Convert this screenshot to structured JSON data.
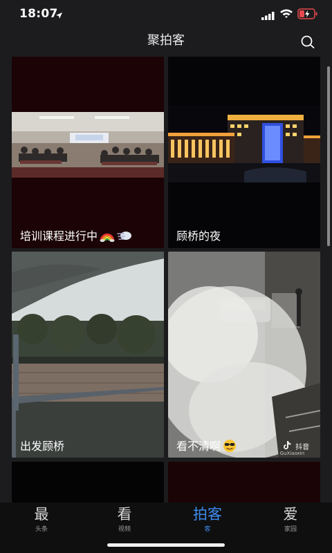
{
  "status_bar": {
    "time": "18:07",
    "icons": [
      "location-arrow-icon",
      "cellular-signal-icon",
      "wifi-icon",
      "battery-charging-icon"
    ]
  },
  "header": {
    "title": "聚拍客",
    "search_icon": "search-icon"
  },
  "grid": [
    {
      "label": "培训课程进行中",
      "emojis": [
        "rainbow-emoji",
        "wind-cloud-emoji"
      ]
    },
    {
      "label": "顾桥的夜",
      "emojis": []
    },
    {
      "label": "出发顾桥",
      "emojis": []
    },
    {
      "label": "看不清啊",
      "emojis": [
        "sunglasses-face-emoji"
      ],
      "watermark_brand": "抖音",
      "watermark_account": "我的抖音号: GuXiaoxin"
    }
  ],
  "tabs": [
    {
      "glyph": "最",
      "sub": "头条",
      "active": false
    },
    {
      "glyph": "看",
      "sub": "视频",
      "active": false
    },
    {
      "glyph": "拍客",
      "sub": "客",
      "active": true
    },
    {
      "glyph": "爱",
      "sub": "家园",
      "active": false
    }
  ],
  "colors": {
    "background": "#1c1c1e",
    "active_tab": "#3d8cf0",
    "battery_level": "#e5484d"
  }
}
